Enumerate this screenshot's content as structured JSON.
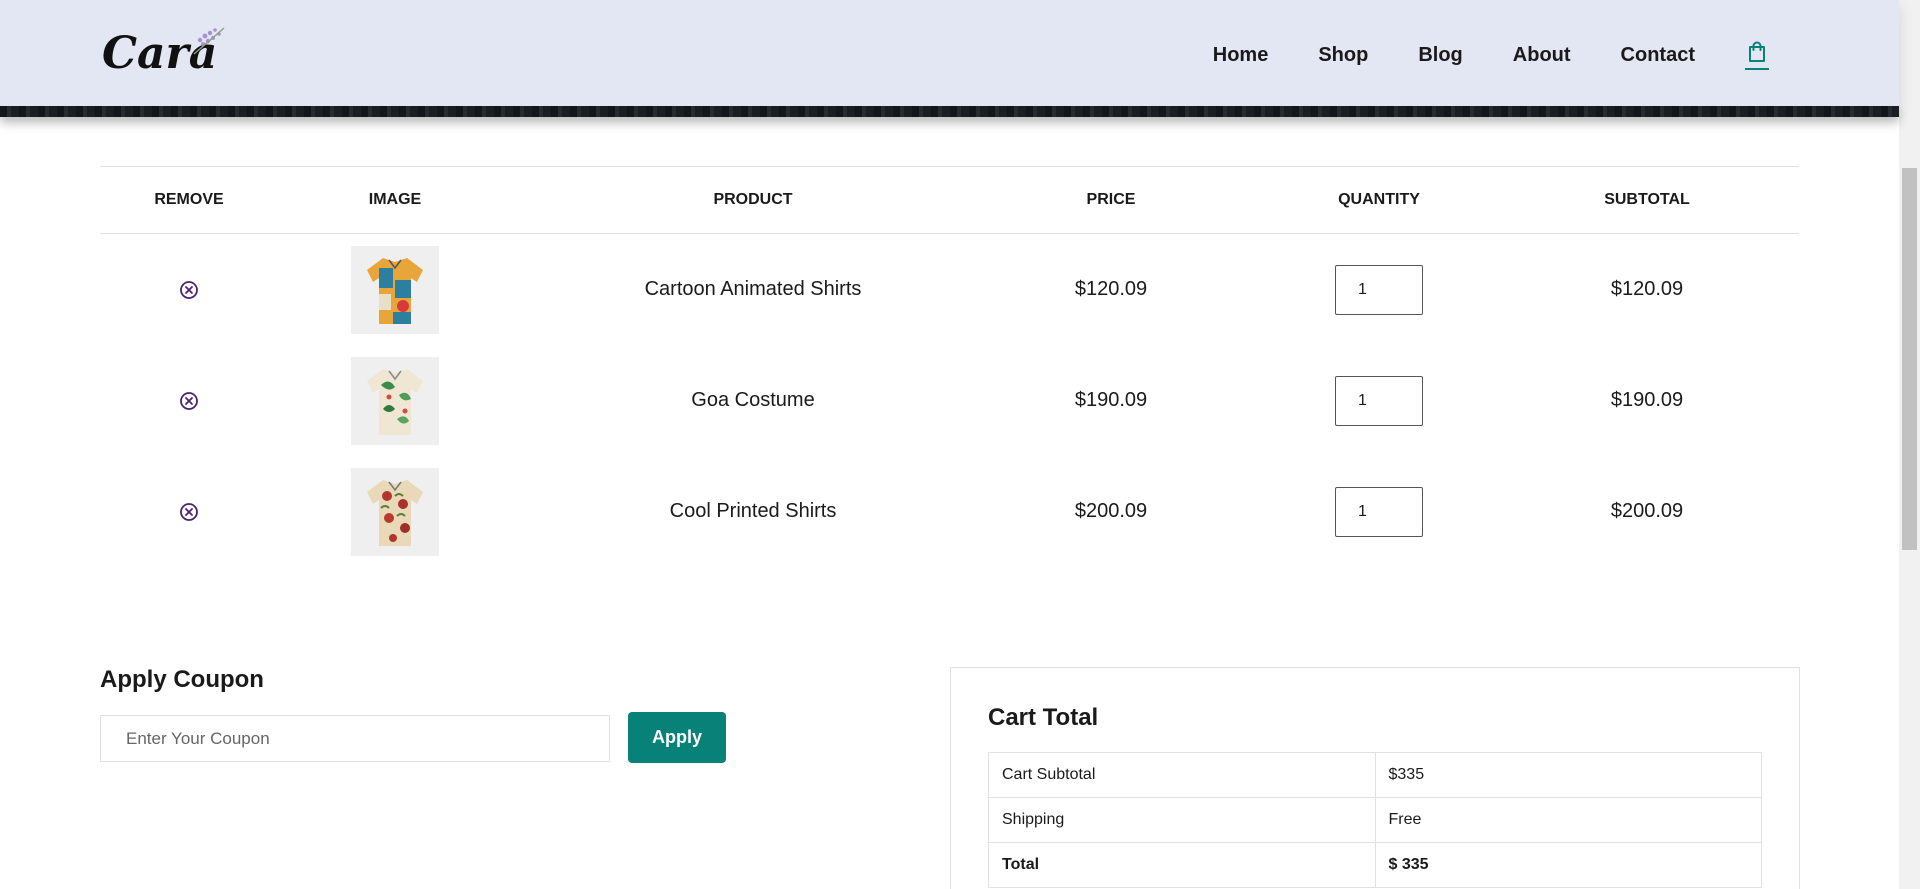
{
  "brand": {
    "logo_text": "Cara"
  },
  "nav": {
    "links": [
      "Home",
      "Shop",
      "Blog",
      "About",
      "Contact"
    ],
    "cart_icon": "shopping-bag-icon",
    "accent": "#088178"
  },
  "table": {
    "headers": [
      "REMOVE",
      "IMAGE",
      "PRODUCT",
      "PRICE",
      "QUANTITY",
      "SUBTOTAL"
    ],
    "rows": [
      {
        "product": "Cartoon Animated Shirts",
        "price": "$120.09",
        "quantity": "1",
        "subtotal": "$120.09"
      },
      {
        "product": "Goa Costume",
        "price": "$190.09",
        "quantity": "1",
        "subtotal": "$190.09"
      },
      {
        "product": "Cool Printed Shirts",
        "price": "$200.09",
        "quantity": "1",
        "subtotal": "$200.09"
      }
    ]
  },
  "coupon": {
    "title": "Apply Coupon",
    "placeholder": "Enter Your Coupon",
    "button": "Apply"
  },
  "totals": {
    "title": "Cart Total",
    "rows": [
      {
        "label": "Cart Subtotal",
        "value": "$335"
      },
      {
        "label": "Shipping",
        "value": "Free"
      },
      {
        "label": "Total",
        "value": "$ 335"
      }
    ]
  },
  "colors": {
    "header_bg": "#e3e6f3",
    "accent": "#088178",
    "remove_icon": "#4b2277"
  }
}
